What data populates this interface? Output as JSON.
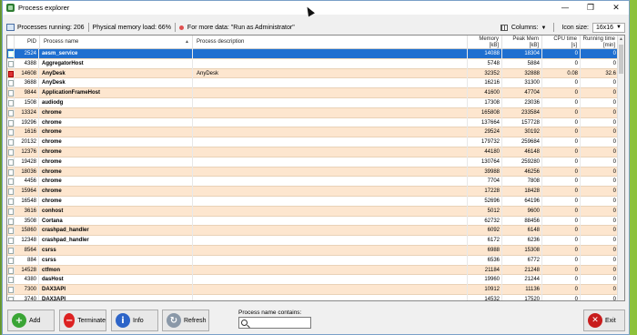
{
  "window": {
    "title": "Process explorer"
  },
  "titlebar_controls": {
    "minimize": "—",
    "maximize": "❐",
    "close": "✕"
  },
  "status": {
    "running": "Processes running: 206",
    "memory_load": "Physical memory load: 66%",
    "more_data": "For more data: \"Run as Administrator\"",
    "columns_label": "Columns:",
    "icon_size_label": "Icon size:",
    "icon_size_value": "16x16"
  },
  "table": {
    "headers": {
      "pid": "PID",
      "name": "Process name",
      "desc": "Process description",
      "mem_line1": "Memory",
      "mem_line2": "[kB]",
      "peak_line1": "Peak Mem",
      "peak_line2": "[kB]",
      "cpu_line1": "CPU time",
      "cpu_line2": "[s]",
      "run_line1": "Running time",
      "run_line2": "[min]"
    },
    "rows": [
      {
        "pid": "2524",
        "name": "aesm_service",
        "desc": "",
        "mem": "14088",
        "peak": "18304",
        "cpu": "0",
        "run": "0"
      },
      {
        "pid": "4388",
        "name": "AggregatorHost",
        "desc": "",
        "mem": "5748",
        "peak": "5884",
        "cpu": "0",
        "run": "0"
      },
      {
        "pid": "14608",
        "name": "AnyDesk",
        "desc": "AnyDesk",
        "mem": "32352",
        "peak": "32888",
        "cpu": "0.08",
        "run": "32.6"
      },
      {
        "pid": "3688",
        "name": "AnyDesk",
        "desc": "",
        "mem": "16216",
        "peak": "31300",
        "cpu": "0",
        "run": "0"
      },
      {
        "pid": "9844",
        "name": "ApplicationFrameHost",
        "desc": "",
        "mem": "41600",
        "peak": "47704",
        "cpu": "0",
        "run": "0"
      },
      {
        "pid": "1508",
        "name": "audiodg",
        "desc": "",
        "mem": "17308",
        "peak": "23036",
        "cpu": "0",
        "run": "0"
      },
      {
        "pid": "13324",
        "name": "chrome",
        "desc": "",
        "mem": "165808",
        "peak": "233584",
        "cpu": "0",
        "run": "0"
      },
      {
        "pid": "19296",
        "name": "chrome",
        "desc": "",
        "mem": "137664",
        "peak": "157728",
        "cpu": "0",
        "run": "0"
      },
      {
        "pid": "1616",
        "name": "chrome",
        "desc": "",
        "mem": "29524",
        "peak": "30192",
        "cpu": "0",
        "run": "0"
      },
      {
        "pid": "20132",
        "name": "chrome",
        "desc": "",
        "mem": "179732",
        "peak": "259684",
        "cpu": "0",
        "run": "0"
      },
      {
        "pid": "12376",
        "name": "chrome",
        "desc": "",
        "mem": "44180",
        "peak": "46148",
        "cpu": "0",
        "run": "0"
      },
      {
        "pid": "19428",
        "name": "chrome",
        "desc": "",
        "mem": "130764",
        "peak": "259280",
        "cpu": "0",
        "run": "0"
      },
      {
        "pid": "18036",
        "name": "chrome",
        "desc": "",
        "mem": "39988",
        "peak": "46256",
        "cpu": "0",
        "run": "0"
      },
      {
        "pid": "4456",
        "name": "chrome",
        "desc": "",
        "mem": "7704",
        "peak": "7808",
        "cpu": "0",
        "run": "0"
      },
      {
        "pid": "15964",
        "name": "chrome",
        "desc": "",
        "mem": "17228",
        "peak": "18428",
        "cpu": "0",
        "run": "0"
      },
      {
        "pid": "16548",
        "name": "chrome",
        "desc": "",
        "mem": "52696",
        "peak": "64196",
        "cpu": "0",
        "run": "0"
      },
      {
        "pid": "3616",
        "name": "conhost",
        "desc": "",
        "mem": "5012",
        "peak": "9600",
        "cpu": "0",
        "run": "0"
      },
      {
        "pid": "3508",
        "name": "Cortana",
        "desc": "",
        "mem": "62732",
        "peak": "88456",
        "cpu": "0",
        "run": "0"
      },
      {
        "pid": "15860",
        "name": "crashpad_handler",
        "desc": "",
        "mem": "6092",
        "peak": "6148",
        "cpu": "0",
        "run": "0"
      },
      {
        "pid": "12348",
        "name": "crashpad_handler",
        "desc": "",
        "mem": "6172",
        "peak": "6236",
        "cpu": "0",
        "run": "0"
      },
      {
        "pid": "8564",
        "name": "csrss",
        "desc": "",
        "mem": "6988",
        "peak": "15308",
        "cpu": "0",
        "run": "0"
      },
      {
        "pid": "884",
        "name": "csrss",
        "desc": "",
        "mem": "6536",
        "peak": "6772",
        "cpu": "0",
        "run": "0"
      },
      {
        "pid": "14528",
        "name": "ctfmon",
        "desc": "",
        "mem": "21184",
        "peak": "21248",
        "cpu": "0",
        "run": "0"
      },
      {
        "pid": "4380",
        "name": "dasHost",
        "desc": "",
        "mem": "19960",
        "peak": "21244",
        "cpu": "0",
        "run": "0"
      },
      {
        "pid": "7300",
        "name": "DAX3API",
        "desc": "",
        "mem": "10912",
        "peak": "11136",
        "cpu": "0",
        "run": "0"
      },
      {
        "pid": "3740",
        "name": "DAX3API",
        "desc": "",
        "mem": "14532",
        "peak": "17520",
        "cpu": "0",
        "run": "0"
      }
    ]
  },
  "buttons": {
    "add": "Add",
    "terminate": "Terminate",
    "info": "Info",
    "refresh": "Refresh",
    "exit": "Exit"
  },
  "search": {
    "label": "Process name contains:",
    "value": ""
  },
  "colors": {
    "selected_row": "#1e6fd0",
    "alt_row": "#fde6cf"
  }
}
